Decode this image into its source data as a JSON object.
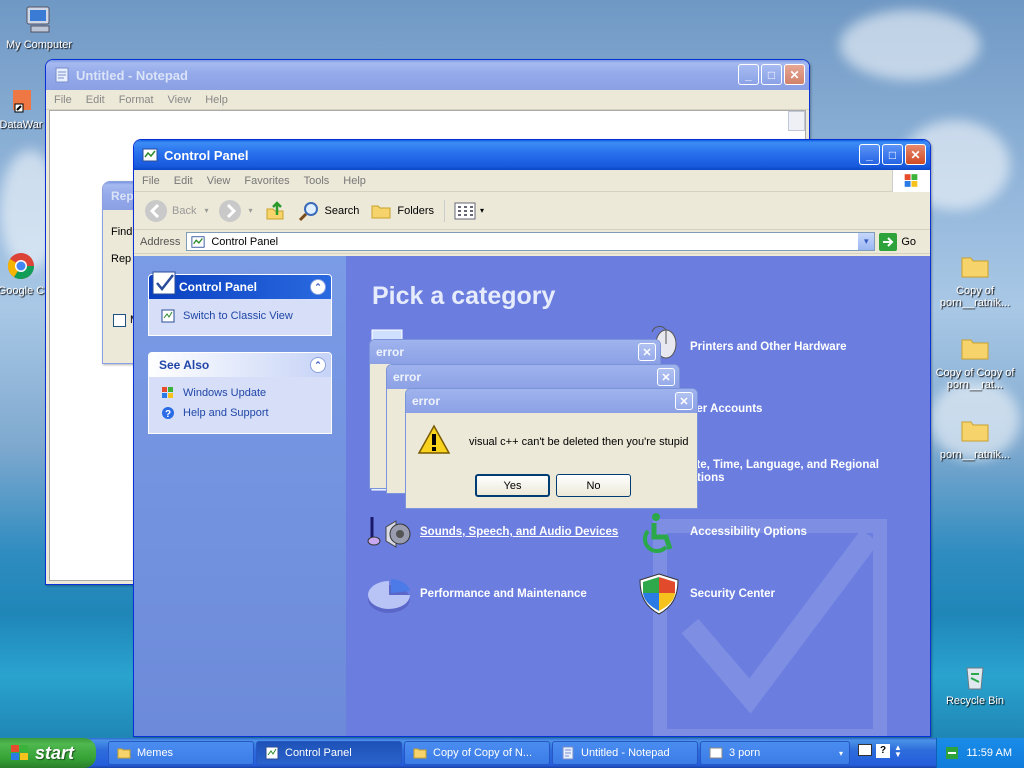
{
  "desktop": {
    "icons": [
      {
        "label": "My Computer",
        "icon": "my-computer-icon"
      },
      {
        "label": "DataWar",
        "icon": "shortcut-icon"
      },
      {
        "label": "Google C",
        "icon": "chrome-icon"
      },
      {
        "label": "Copy of porn__ratnik...",
        "icon": "folder-icon"
      },
      {
        "label": "Copy of Copy of porn__rat...",
        "icon": "folder-icon"
      },
      {
        "label": "porn__ratnik...",
        "icon": "folder-icon"
      },
      {
        "label": "Recycle Bin",
        "icon": "recycle-bin-icon"
      }
    ]
  },
  "notepad": {
    "title": "Untitled - Notepad",
    "menu": [
      "File",
      "Edit",
      "Format",
      "View",
      "Help"
    ]
  },
  "replace_dialog": {
    "title": "Rep",
    "find_label": "Find",
    "replace_label": "Rep",
    "checkbox_label": "M"
  },
  "control_panel": {
    "title": "Control Panel",
    "menu": [
      "File",
      "Edit",
      "View",
      "Favorites",
      "Tools",
      "Help"
    ],
    "toolbar": {
      "back": "Back",
      "search": "Search",
      "folders": "Folders"
    },
    "address_label": "Address",
    "address_value": "Control Panel",
    "go_label": "Go",
    "sidebar": {
      "box1_title": "Control Panel",
      "switch_link": "Switch to Classic View",
      "box2_title": "See Also",
      "see_also": [
        "Windows Update",
        "Help and Support"
      ]
    },
    "heading": "Pick a category",
    "categories": [
      "Printers and Other Hardware",
      "User Accounts",
      "Date, Time, Language, and Regional Options",
      "Sounds, Speech, and Audio Devices",
      "Accessibility Options",
      "Performance and Maintenance",
      "Security Center"
    ],
    "partial_categories": [
      "ser Accounts",
      "ate, Time, Language, and Regional",
      "ptions"
    ]
  },
  "error_dialogs": {
    "title": "error",
    "message": "visual c++ can't be deleted then you're stupid",
    "yes": "Yes",
    "no": "No"
  },
  "taskbar": {
    "start": "start",
    "tasks": [
      "Memes",
      "Control Panel",
      "Copy of Copy of N...",
      "Untitled - Notepad",
      "3 porn"
    ],
    "clock": "11:59 AM"
  },
  "colors": {
    "xp_blue": "#245edb",
    "cp_main": "#6b7ee0",
    "start_green": "#35a135"
  }
}
